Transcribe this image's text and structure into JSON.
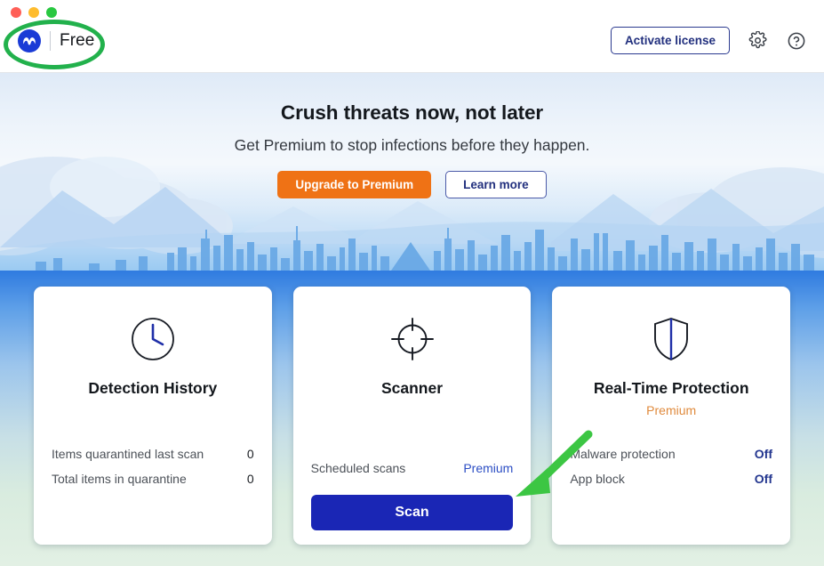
{
  "window": {
    "traffic_lights": [
      {
        "name": "close",
        "color": "#ff5f57"
      },
      {
        "name": "minimize",
        "color": "#febc2e"
      },
      {
        "name": "zoom",
        "color": "#28c840"
      }
    ]
  },
  "titlebar": {
    "logo_icon": "malwarebytes-logo-icon",
    "edition_label": "Free",
    "activate_label": "Activate license",
    "settings_icon": "gear-icon",
    "help_icon": "help-icon"
  },
  "hero": {
    "title": "Crush threats now, not later",
    "subtitle": "Get Premium to stop infections before they happen.",
    "primary_button": "Upgrade to Premium",
    "secondary_button": "Learn more",
    "primary_color": "#ef7215",
    "secondary_color": "#22307e"
  },
  "cards": [
    {
      "id": "detection-history",
      "icon": "clock-icon",
      "title": "Detection History",
      "badge": null,
      "rows": [
        {
          "label": "Items quarantined last scan",
          "value": "0",
          "style": "plain"
        },
        {
          "label": "Total items in quarantine",
          "value": "0",
          "style": "plain"
        }
      ],
      "button": null
    },
    {
      "id": "scanner",
      "icon": "crosshair-icon",
      "title": "Scanner",
      "badge": null,
      "rows": [
        {
          "label": "Scheduled scans",
          "value": "Premium",
          "style": "link"
        }
      ],
      "button": {
        "label": "Scan",
        "color": "#1a26b5"
      }
    },
    {
      "id": "real-time-protection",
      "icon": "shield-icon",
      "title": "Real-Time Protection",
      "badge": "Premium",
      "badge_color": "#e08a3c",
      "rows": [
        {
          "label": "Malware protection",
          "value": "Off",
          "style": "off"
        },
        {
          "label": "App block",
          "value": "Off",
          "style": "off"
        }
      ],
      "button": null
    }
  ],
  "annotations": [
    {
      "type": "ellipse",
      "target": "logo-free-badge",
      "color": "#22b14c"
    },
    {
      "type": "arrow",
      "target": "scan-button",
      "color": "#3cc643",
      "direction": "down-left"
    }
  ]
}
